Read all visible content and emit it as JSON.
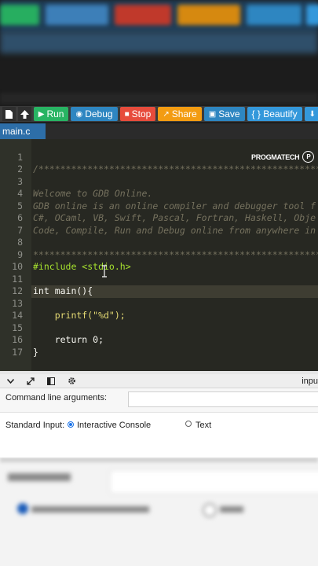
{
  "toolbar": {
    "run": "Run",
    "debug": "Debug",
    "stop": "Stop",
    "share": "Share",
    "save": "Save",
    "beautify": "{ } Beautify"
  },
  "file_tab": "main.c",
  "watermark": "PROGMATECH",
  "editor": {
    "lines": [
      {
        "n": "1",
        "text": "/****************************************************************"
      },
      {
        "n": "2",
        "text": ""
      },
      {
        "n": "3",
        "text": "Welcome to GDB Online."
      },
      {
        "n": "4",
        "text": "GDB online is an online compiler and debugger tool f"
      },
      {
        "n": "5",
        "text": "C#, OCaml, VB, Swift, Pascal, Fortran, Haskell, Obje"
      },
      {
        "n": "6",
        "text": "Code, Compile, Run and Debug online from anywhere in"
      },
      {
        "n": "7",
        "text": ""
      },
      {
        "n": "8",
        "text": "****************************************************************"
      },
      {
        "n": "9",
        "text": "#include <stdio.h>"
      },
      {
        "n": "10",
        "text": ""
      },
      {
        "n": "11",
        "text": "int main(){"
      },
      {
        "n": "12",
        "text": ""
      },
      {
        "n": "13",
        "text": "    printf(\"%d\");"
      },
      {
        "n": "14",
        "text": ""
      },
      {
        "n": "15",
        "text": "    return 0;"
      },
      {
        "n": "16",
        "text": "}"
      },
      {
        "n": "17",
        "text": ""
      }
    ]
  },
  "panel": {
    "input_tab": "inpu",
    "command_line_label": "Command line arguments:",
    "standard_input_label": "Standard Input:",
    "option_interactive": "Interactive Console",
    "option_text": "Text"
  },
  "colors": {
    "run": "#28b463",
    "debug": "#2e86c1",
    "stop": "#e74c3c",
    "share": "#f39c12",
    "editor_bg": "#272822"
  }
}
